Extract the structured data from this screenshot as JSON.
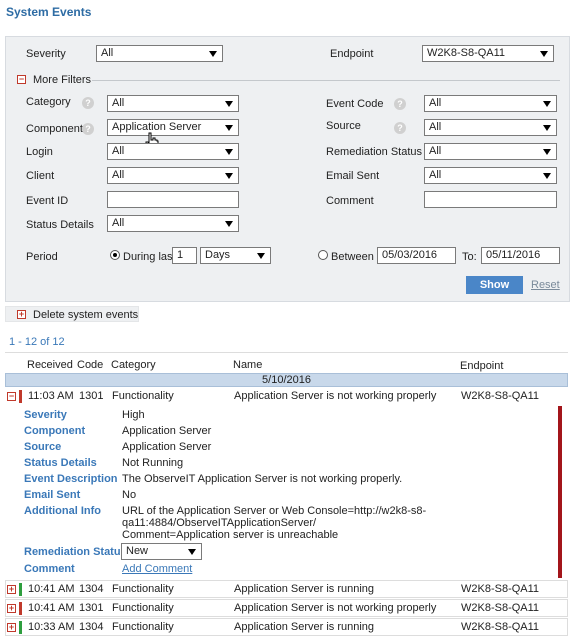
{
  "page": {
    "title": "System Events"
  },
  "filters": {
    "severity": {
      "label": "Severity",
      "value": "All"
    },
    "endpoint": {
      "label": "Endpoint",
      "value": "W2K8-S8-QA11"
    },
    "more_filters": "More Filters",
    "category": {
      "label": "Category",
      "value": "All"
    },
    "event_code": {
      "label": "Event Code",
      "value": "All"
    },
    "component": {
      "label": "Component",
      "value": "Application Server"
    },
    "source": {
      "label": "Source",
      "value": "All"
    },
    "login": {
      "label": "Login",
      "value": "All"
    },
    "remediation_status": {
      "label": "Remediation Status",
      "value": "All"
    },
    "client": {
      "label": "Client",
      "value": "All"
    },
    "email_sent": {
      "label": "Email Sent",
      "value": "All"
    },
    "event_id": {
      "label": "Event ID",
      "value": ""
    },
    "comment": {
      "label": "Comment",
      "value": ""
    },
    "status_details": {
      "label": "Status Details",
      "value": "All"
    },
    "period": {
      "label": "Period",
      "during_last_label": "During last",
      "during_last_value": "1",
      "unit": "Days",
      "between_label": "Between",
      "from": "05/03/2016",
      "to_label": "To:",
      "to": "05/11/2016"
    },
    "show_label": "Show",
    "reset_label": "Reset",
    "help_glyph": "?"
  },
  "actions": {
    "delete_label": "Delete system events",
    "expand_glyph": "+",
    "collapse_glyph": "−"
  },
  "results": {
    "count_text": "1 - 12 of 12"
  },
  "table": {
    "headers": {
      "received": "Received",
      "code": "Code",
      "category": "Category",
      "name": "Name",
      "endpoint": "Endpoint"
    },
    "date_group": "5/10/2016",
    "expanded_row": {
      "time": "11:03 AM",
      "code": "1301",
      "category": "Functionality",
      "name": "Application Server is not working properly",
      "endpoint": "W2K8-S8-QA11",
      "severity_color": "#c0392b"
    },
    "details": {
      "severity": {
        "label": "Severity",
        "value": "High"
      },
      "component": {
        "label": "Component",
        "value": "Application Server"
      },
      "source": {
        "label": "Source",
        "value": "Application Server"
      },
      "status_details": {
        "label": "Status Details",
        "value": "Not Running"
      },
      "event_description": {
        "label": "Event Description",
        "value": "The ObserveIT Application Server is not working properly."
      },
      "email_sent": {
        "label": "Email Sent",
        "value": "No"
      },
      "additional_info": {
        "label": "Additional Info",
        "line1": "URL of the Application Server or Web Console=http://w2k8-s8-",
        "line2": "qa11:4884/ObserveITApplicationServer/",
        "line3": "Comment=Application server is unreachable"
      },
      "remediation_status": {
        "label": "Remediation Status",
        "value": "New"
      },
      "comment": {
        "label": "Comment",
        "link": "Add Comment"
      }
    },
    "rows": [
      {
        "time": "10:41 AM",
        "code": "1304",
        "category": "Functionality",
        "name": "Application Server is running",
        "endpoint": "W2K8-S8-QA11",
        "severity_color": "#2e9e3e"
      },
      {
        "time": "10:41 AM",
        "code": "1301",
        "category": "Functionality",
        "name": "Application Server is not working properly",
        "endpoint": "W2K8-S8-QA11",
        "severity_color": "#c0392b"
      },
      {
        "time": "10:33 AM",
        "code": "1304",
        "category": "Functionality",
        "name": "Application Server is running",
        "endpoint": "W2K8-S8-QA11",
        "severity_color": "#2e9e3e"
      }
    ]
  },
  "colors": {
    "accent": "#2e6ca4",
    "link": "#3a78b8",
    "high": "#c0392b",
    "ok": "#2e9e3e",
    "button": "#4a86c8"
  }
}
